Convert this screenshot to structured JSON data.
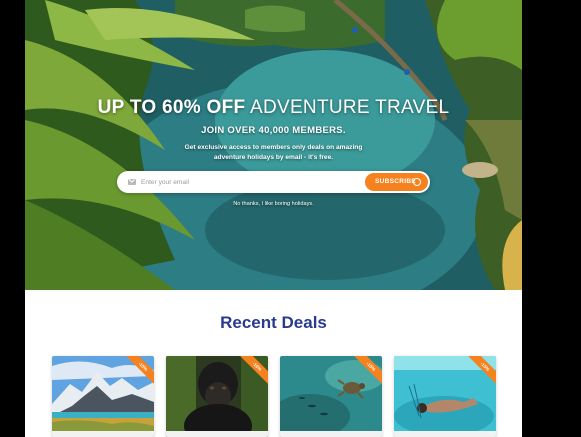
{
  "hero": {
    "headline_bold": "UP TO 60% OFF",
    "headline_light": "ADVENTURE TRAVEL",
    "members": "JOIN OVER 40,000 MEMBERS.",
    "description": "Get exclusive access to members only deals on amazing adventure holidays by email - it's free.",
    "email_placeholder": "Enter your email",
    "subscribe_label": "SUBSCRIBE",
    "no_thanks": "No thanks, I like boring holidays.",
    "mail_icon": "envelope-icon",
    "subscribe_icon": "circle-arrow-icon"
  },
  "deals": {
    "title": "Recent Deals",
    "items": [
      {
        "badge": "-15%",
        "scene": "patagonia-mountains"
      },
      {
        "badge": "-10%",
        "scene": "gorilla"
      },
      {
        "badge": "-15%",
        "scene": "sea-turtle"
      },
      {
        "badge": "-15%",
        "scene": "snorkeling-diver"
      }
    ]
  },
  "colors": {
    "accent": "#f5811f",
    "title": "#2a3b8f",
    "backdrop": "#000000"
  }
}
